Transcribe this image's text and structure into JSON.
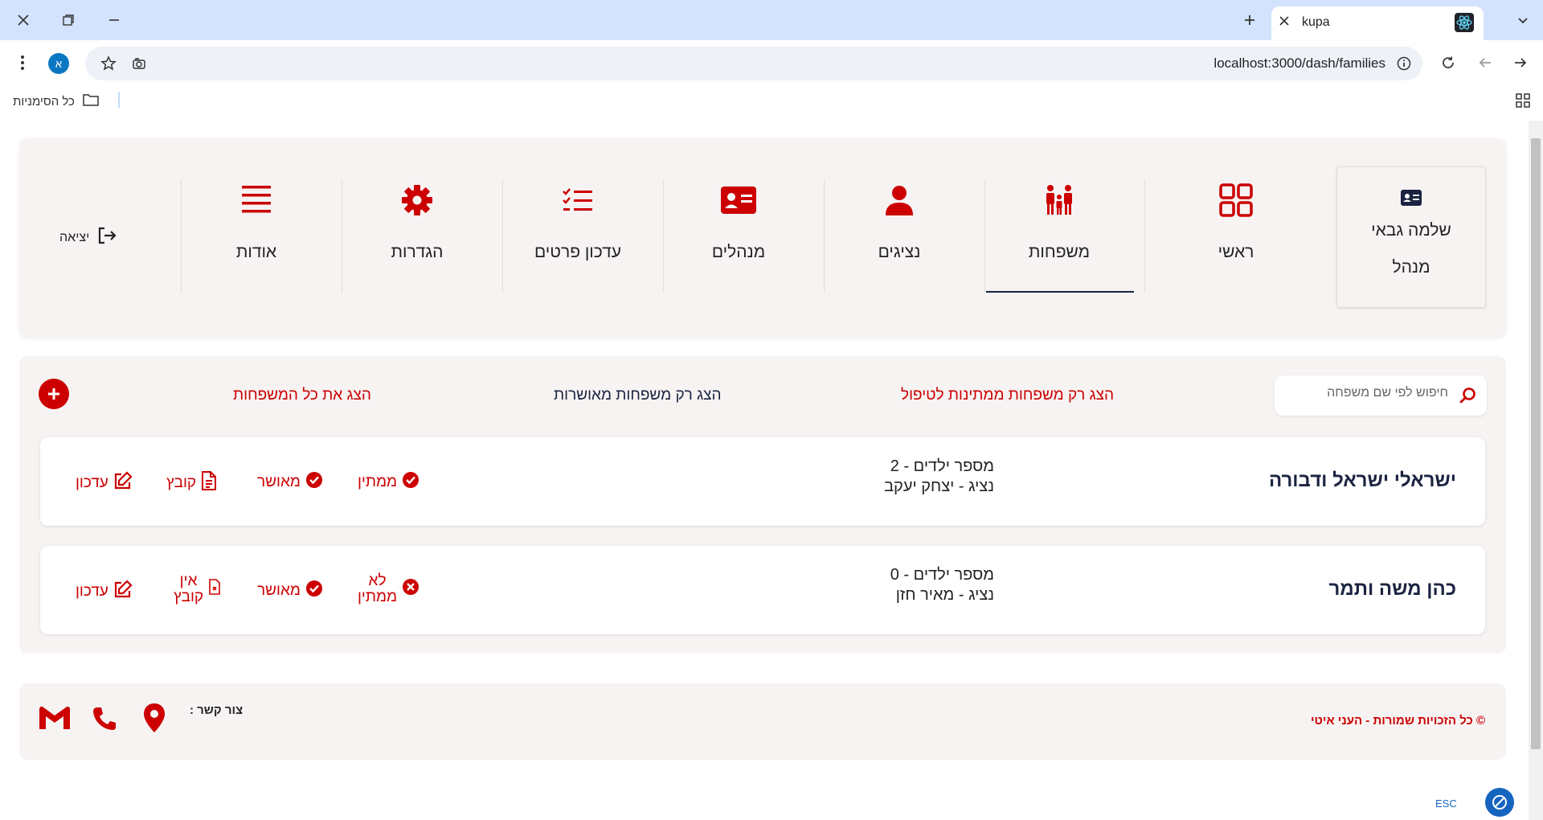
{
  "browser": {
    "tab_title": "kupa",
    "url": "localhost:3000/dash/families",
    "profile_initial": "א",
    "bookmarks_label": "כל הסימניות",
    "icons": [
      "close-window-icon",
      "restore-window-icon",
      "minimize-window-icon",
      "new-tab-icon",
      "tab-search-icon",
      "menu-dots-icon",
      "star-icon",
      "extension-icon",
      "site-info-icon",
      "reload-icon",
      "back-icon",
      "forward-icon",
      "apps-grid-icon",
      "folder-icon"
    ]
  },
  "nav": {
    "user_name": "שלמה גבאי",
    "user_role": "מנהל",
    "items": [
      {
        "label": "ראשי",
        "icon": "grid-icon"
      },
      {
        "label": "משפחות",
        "icon": "family-icon",
        "active": true
      },
      {
        "label": "נציגים",
        "icon": "person-icon"
      },
      {
        "label": "מנהלים",
        "icon": "id-card-icon"
      },
      {
        "label": "עדכון פרטים",
        "icon": "checklist-icon"
      },
      {
        "label": "הגדרות",
        "icon": "gear-icon"
      },
      {
        "label": "אודות",
        "icon": "menu-lines-icon"
      }
    ],
    "logout_label": "יציאה"
  },
  "families_panel": {
    "search_placeholder": "חיפוש לפי שם משפחה",
    "filters": {
      "pending": "הצג רק משפחות ממתינות לטיפול",
      "approved": "הצג רק משפחות מאושרות",
      "all": "הצג את כל המשפחות"
    },
    "families": [
      {
        "name": "ישראלי ישראל ודבורה",
        "children": "מספר ילדים - 2",
        "representative": "נציג - יצחק יעקב",
        "pending_label": "ממתין",
        "pending_status": "check",
        "approved_label": "מאושר",
        "file_label": "קובץ",
        "edit_label": "עדכון"
      },
      {
        "name": "כהן משה ותמר",
        "children": "מספר ילדים - 0",
        "representative": "נציג - מאיר חזן",
        "pending_label_1": "לא",
        "pending_label_2": "ממתין",
        "pending_status": "x",
        "approved_label": "מאושר",
        "file_label_1": "אין",
        "file_label_2": "קובץ",
        "edit_label": "עדכון"
      }
    ]
  },
  "footer": {
    "copyright": "© כל הזכויות שמורות - העני איטי",
    "contact_label": "צור קשר :",
    "contact_icons": [
      "location-icon",
      "phone-icon",
      "gmail-icon"
    ]
  },
  "accessibility": {
    "esc_label": "ESC"
  },
  "colors": {
    "accent": "#cc0000",
    "dark": "#1a2340",
    "panel_bg": "#f7f3f3",
    "chrome_bg": "#d3e3fd"
  }
}
